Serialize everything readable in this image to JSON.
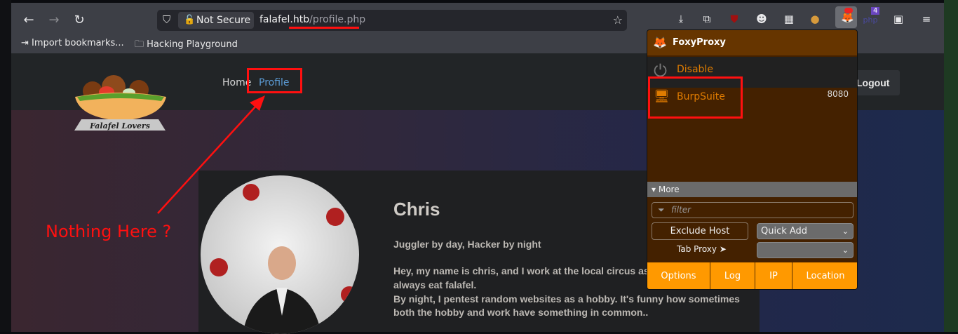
{
  "browser": {
    "not_secure": "Not Secure",
    "url_host": "falafel.htb",
    "url_path": "/profile.php",
    "bookmarks": [
      "Import bookmarks...",
      "Hacking Playground"
    ],
    "extension_badge": "4"
  },
  "site": {
    "logo_text": "Falafel Lovers",
    "nav": [
      "Home",
      "Profile"
    ],
    "logout": "Logout",
    "profile": {
      "name": "Chris",
      "tagline": "Juggler by day, Hacker by night",
      "bio_lines": [
        "Hey, my name is chris, and I work at the local circus as",
        "always eat falafel.",
        "By night, I pentest random websites as a hobby. It's funny how sometimes",
        "both the hobby and work have something in common.."
      ]
    }
  },
  "foxyproxy": {
    "title": "FoxyProxy",
    "disable": "Disable",
    "proxy_name": "BurpSuite",
    "proxy_port": "8080",
    "more": "More",
    "filter_placeholder": "filter",
    "exclude_host": "Exclude Host",
    "quick_add": "Quick Add",
    "tab_proxy": "Tab Proxy",
    "tab_proxy_value": "",
    "footer": [
      "Options",
      "Log",
      "IP",
      "Location"
    ],
    "colors": {
      "header": "#663500",
      "body": "#442100",
      "accent": "#ff9900",
      "text": "#e07c00"
    }
  },
  "annotation": {
    "text": "Nothing Here ?",
    "color": "#ff1010"
  }
}
